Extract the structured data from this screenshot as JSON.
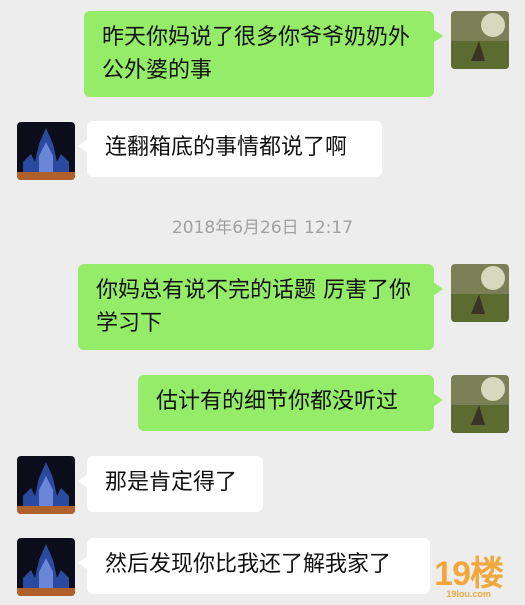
{
  "conversation": {
    "messages": [
      {
        "sender": "self",
        "text": "昨天你妈说了很多你爷爷奶奶外公外婆的事"
      },
      {
        "sender": "other",
        "text": "连翻箱底的事情都说了啊"
      },
      {
        "sender": "self",
        "text": "你妈总有说不完的话题 厉害了你学习下"
      },
      {
        "sender": "self",
        "text": "估计有的细节你都没听过"
      },
      {
        "sender": "other",
        "text": "那是肯定得了"
      },
      {
        "sender": "other",
        "text": "然后发现你比我还了解我家了"
      }
    ],
    "timestamp": "2018年6月26日 12:17"
  },
  "watermark": {
    "text": "19楼",
    "sub": "19lou.com"
  },
  "colors": {
    "self_bubble": "#95ec69",
    "other_bubble": "#ffffff",
    "background": "#ededed"
  }
}
